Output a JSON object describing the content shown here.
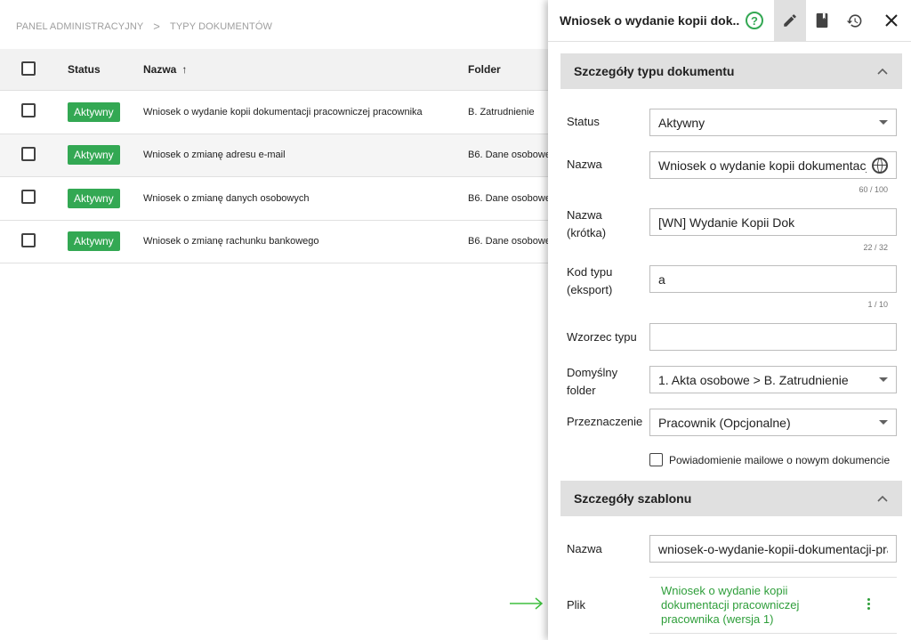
{
  "breadcrumb": {
    "root": "PANEL ADMINISTRACYJNY",
    "separator": ">",
    "current": "TYPY DOKUMENTÓW"
  },
  "table": {
    "headers": {
      "status": "Status",
      "name": "Nazwa",
      "folder": "Folder",
      "sort_icon": "arrow-up-icon"
    },
    "rows": [
      {
        "status": "Aktywny",
        "name": "Wniosek o wydanie kopii dokumentacji pracowniczej pracownika",
        "folder": "B. Zatrudnienie"
      },
      {
        "status": "Aktywny",
        "name": "Wniosek o zmianę adresu e-mail",
        "folder": "B6. Dane osobowe"
      },
      {
        "status": "Aktywny",
        "name": "Wniosek o zmianę danych osobowych",
        "folder": "B6. Dane osobowe"
      },
      {
        "status": "Aktywny",
        "name": "Wniosek o zmianę rachunku bankowego",
        "folder": "B6. Dane osobowe"
      }
    ]
  },
  "panel": {
    "title": "Wniosek o wydanie kopii dok...",
    "help": "?",
    "icons": [
      "help-icon",
      "edit-icon",
      "document-icon",
      "history-icon",
      "close-icon"
    ],
    "section_details": "Szczegóły typu dokumentu",
    "status_label": "Status",
    "status_value": "Aktywny",
    "name_label": "Nazwa",
    "name_value": "Wniosek o wydanie kopii dokumentacji pracowniczej pracownika",
    "name_counter": "60 / 100",
    "short_label": "Nazwa (krótka)",
    "short_value": "[WN] Wydanie Kopii Dok",
    "short_counter": "22 / 32",
    "code_label": "Kod typu (eksport)",
    "code_value": "a",
    "code_counter": "1 / 10",
    "pattern_label": "Wzorzec typu",
    "pattern_value": "",
    "folder_label": "Domyślny folder",
    "folder_value": "1. Akta osobowe > B. Zatrudnienie",
    "purpose_label": "Przeznaczenie",
    "purpose_value": "Pracownik (Opcjonalne)",
    "notify_label": "Powiadomienie mailowe o nowym dokumencie",
    "section_template": "Szczegóły szablonu",
    "tpl_name_label": "Nazwa",
    "tpl_name_value": "wniosek-o-wydanie-kopii-dokumentacji-pracowniczej-pracownika",
    "file_label": "Plik",
    "file_value": "Wniosek o wydanie kopii dokumentacji pracowniczej pracownika (wersja 1)"
  },
  "colors": {
    "accent": "#33a853",
    "link": "#2e9e3a",
    "section_bg": "#e0e0e0"
  }
}
